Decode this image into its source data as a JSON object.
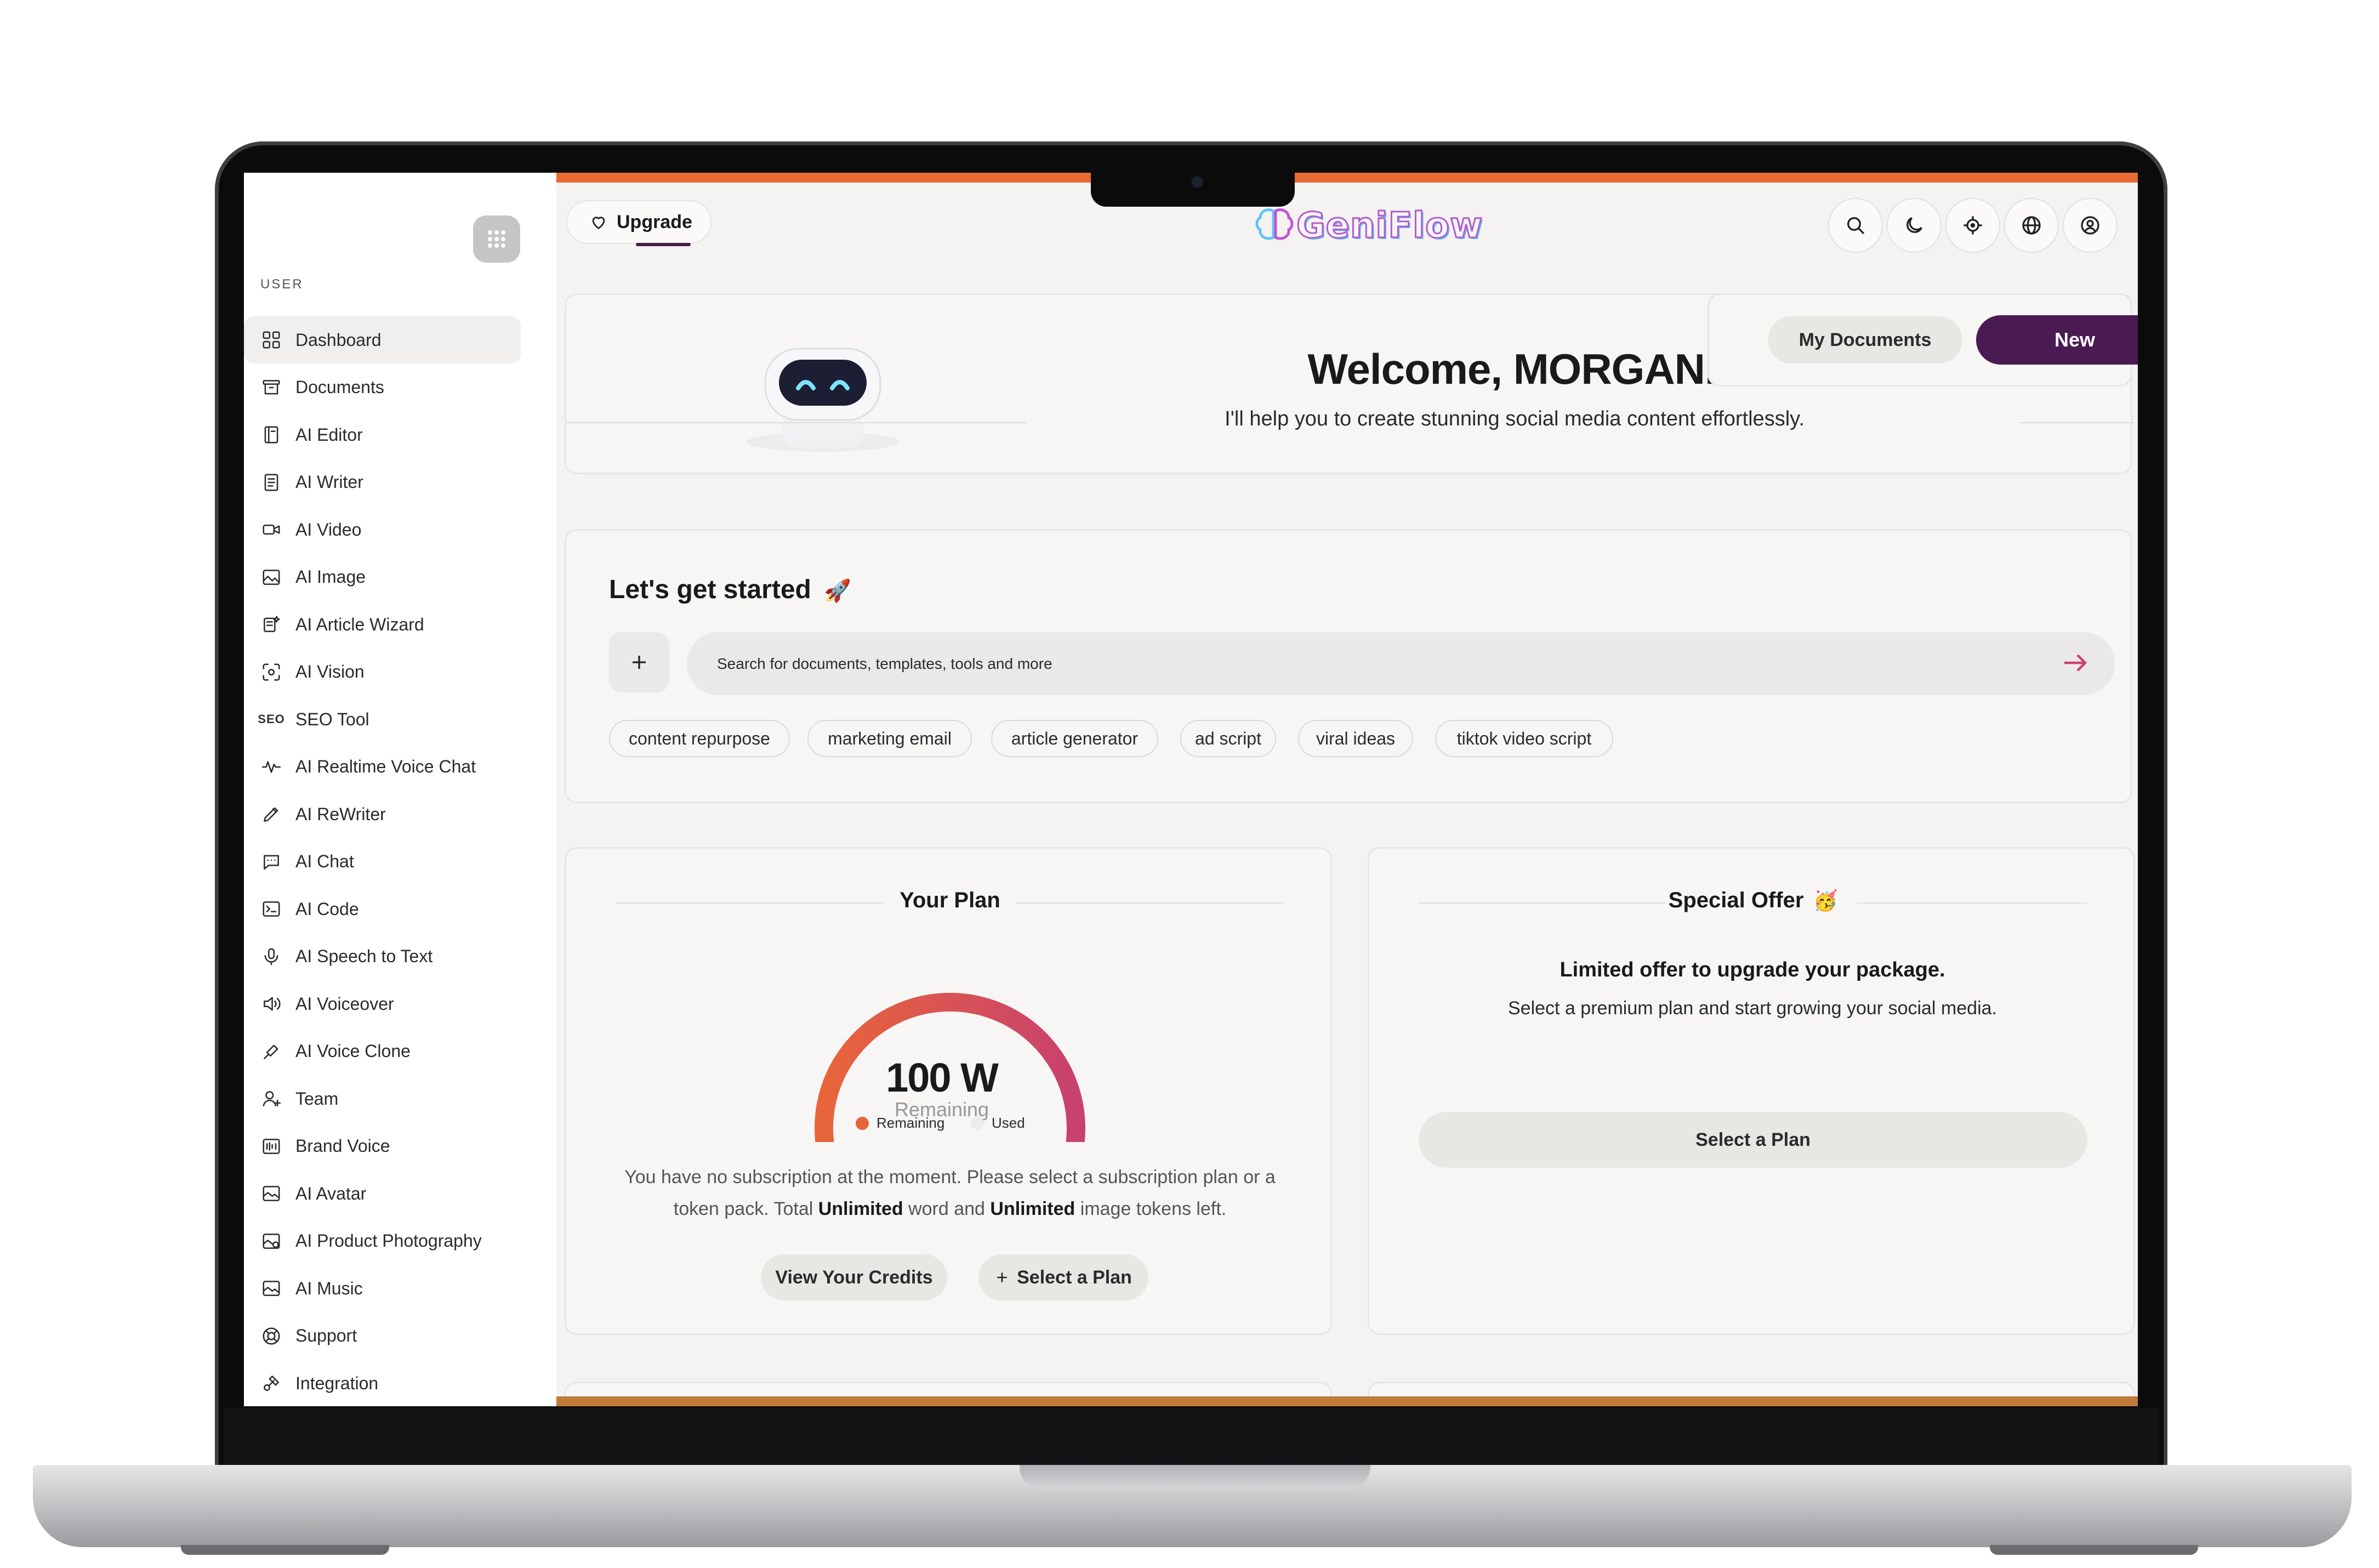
{
  "sidebar": {
    "section_label": "USER",
    "items": [
      {
        "label": "Dashboard",
        "icon": "dashboard-icon",
        "active": true
      },
      {
        "label": "Documents",
        "icon": "archive-icon"
      },
      {
        "label": "AI Editor",
        "icon": "book-icon"
      },
      {
        "label": "AI Writer",
        "icon": "document-icon"
      },
      {
        "label": "AI Video",
        "icon": "video-camera-icon"
      },
      {
        "label": "AI Image",
        "icon": "image-icon"
      },
      {
        "label": "AI Article Wizard",
        "icon": "article-wizard-icon"
      },
      {
        "label": "AI Vision",
        "icon": "vision-icon"
      },
      {
        "label": "SEO Tool",
        "icon": "seo-icon",
        "icon_text": "SEO"
      },
      {
        "label": "AI Realtime Voice Chat",
        "icon": "waveform-icon"
      },
      {
        "label": "AI ReWriter",
        "icon": "pen-icon"
      },
      {
        "label": "AI Chat",
        "icon": "chat-icon"
      },
      {
        "label": "AI Code",
        "icon": "terminal-icon"
      },
      {
        "label": "AI Speech to Text",
        "icon": "microphone-icon"
      },
      {
        "label": "AI Voiceover",
        "icon": "speaker-icon"
      },
      {
        "label": "AI Voice Clone",
        "icon": "voice-clone-icon"
      },
      {
        "label": "Team",
        "icon": "add-user-icon"
      },
      {
        "label": "Brand Voice",
        "icon": "brand-voice-icon"
      },
      {
        "label": "AI Avatar",
        "icon": "avatar-image-icon"
      },
      {
        "label": "AI Product Photography",
        "icon": "product-photo-icon"
      },
      {
        "label": "AI Music",
        "icon": "music-icon"
      },
      {
        "label": "Support",
        "icon": "lifebuoy-icon"
      },
      {
        "label": "Integration",
        "icon": "integration-icon"
      }
    ]
  },
  "header": {
    "upgrade_label": "Upgrade",
    "logo_text": "GeniFlow",
    "icons": [
      "search-icon",
      "moon-icon",
      "crosshair-icon",
      "globe-icon",
      "user-circle-icon"
    ]
  },
  "welcome": {
    "title": "Welcome, MORGAN.",
    "subtitle": "I'll help you to create stunning social media content effortlessly.",
    "my_documents_label": "My Documents",
    "new_label": "New"
  },
  "get_started": {
    "title": "Let's get started",
    "title_emoji": "🚀",
    "search_placeholder": "Search for documents, templates, tools and more",
    "chips": [
      "content repurpose",
      "marketing email",
      "article generator",
      "ad script",
      "viral ideas",
      "tiktok video script"
    ]
  },
  "plan": {
    "title": "Your Plan",
    "gauge_value": "100 W",
    "gauge_label": "Remaining",
    "remaining_fraction": 1.0,
    "legend_remaining": "Remaining",
    "legend_used": "Used",
    "description_pre": "You have no subscription at the moment. Please select a subscription plan or a token pack. Total ",
    "description_words": "Unlimited",
    "description_mid": " word and ",
    "description_images": "Unlimited",
    "description_post": " image tokens left.",
    "view_credits_label": "View Your Credits",
    "select_plan_label": "Select a Plan"
  },
  "offer": {
    "title": "Special Offer",
    "title_emoji": "🥳",
    "headline": "Limited offer to upgrade your package.",
    "text": "Select a premium plan and start growing your social media.",
    "button_label": "Select a Plan"
  },
  "colors": {
    "accent_orange": "#e86a35",
    "new_button": "#4a1a52",
    "gauge_start": "#e8653a",
    "gauge_end": "#c8416f"
  }
}
